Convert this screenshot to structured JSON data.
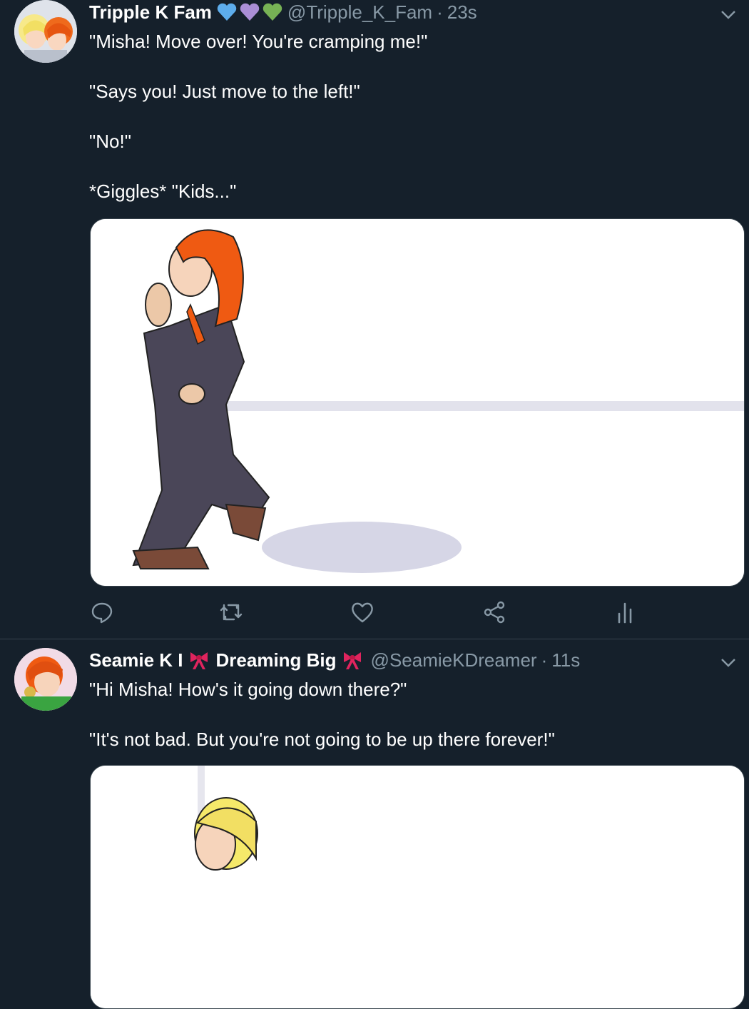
{
  "tweets": [
    {
      "author": "Tripple K Fam",
      "emoji": [
        "blue-heart",
        "purple-heart",
        "green-heart"
      ],
      "handle": "@Tripple_K_Fam",
      "separator": "·",
      "time": "23s",
      "text": [
        "\"Misha! Move over! You're cramping me!\"",
        "\"Says you! Just move to the left!\"",
        "\"No!\"",
        "*Giggles* \"Kids...\""
      ],
      "media_alt": "drawing of a red-haired character in a long coat"
    },
    {
      "author_part1": "Seamie K I",
      "author_part2": "Dreaming Big",
      "emoji": [
        "ribbon",
        "ribbon"
      ],
      "handle": "@SeamieKDreamer",
      "separator": "·",
      "time": "11s",
      "text": [
        "\"Hi Misha! How's it going down there?\"",
        "\"It's not bad. But you're not going to be up there forever!\""
      ]
    }
  ],
  "actions": [
    "reply-icon",
    "retweet-icon",
    "like-icon",
    "share-icon",
    "analytics-icon"
  ],
  "colors": {
    "background": "#15202b",
    "secondary_text": "#8899a6",
    "divider": "#38444d"
  }
}
